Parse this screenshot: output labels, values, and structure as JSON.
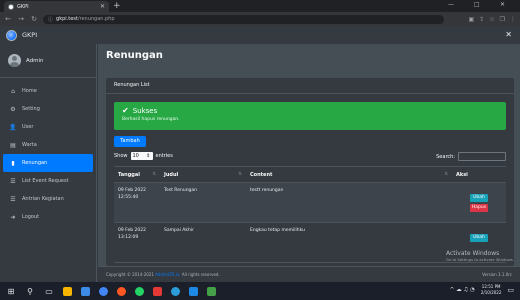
{
  "browser": {
    "tab_title": "GKPI",
    "url_host": "gkpi.test",
    "url_path": "/renungan.php"
  },
  "app": {
    "brand": "GKPI",
    "user": "Admin"
  },
  "sidebar": {
    "items": [
      {
        "label": "Home",
        "icon": "home-icon",
        "glyph": "⌂"
      },
      {
        "label": "Setting",
        "icon": "gears-icon",
        "glyph": "⚙"
      },
      {
        "label": "User",
        "icon": "user-icon",
        "glyph": "👤"
      },
      {
        "label": "Warta",
        "icon": "newspaper-icon",
        "glyph": "▤"
      },
      {
        "label": "Renungan",
        "icon": "book-icon",
        "glyph": "▮",
        "active": true
      },
      {
        "label": "List Event Request",
        "icon": "list-icon",
        "glyph": "☰"
      },
      {
        "label": "Antrian Kegiatan",
        "icon": "list-icon",
        "glyph": "☰"
      },
      {
        "label": "Logout",
        "icon": "logout-icon",
        "glyph": "➜"
      }
    ]
  },
  "main": {
    "page_title": "Renungan",
    "card_title": "Renungan List",
    "alert": {
      "title": "Sukses",
      "message": "Berhasil hapus renungan."
    },
    "add_button": "Tambah",
    "show_label": "Show",
    "entries_value": "10",
    "entries_label": "entries",
    "search_label": "Search:",
    "table": {
      "headers": [
        "Tanggal",
        "Judul",
        "Content",
        "Aksi"
      ],
      "rows": [
        {
          "tanggal": "09 Feb 2022",
          "jam": "12:55:40",
          "judul": "Test Renungan",
          "content": "testt renungan",
          "ubah": "Ubah",
          "hapus": "Hapus"
        },
        {
          "tanggal": "09 Feb 2022",
          "jam": "13:12:09",
          "judul": "Sampai Akhir",
          "content": "Engkau tetap memilihku",
          "ubah": "Ubah"
        }
      ]
    }
  },
  "footer": {
    "copyright_prefix": "Copyright © 2014-2021",
    "copyright_link": "AdminLTE.io.",
    "copyright_suffix": "All rights reserved.",
    "version": "Version 3.1.0rc"
  },
  "watermark": {
    "title": "Activate Windows",
    "subtitle": "Go to Settings to activate Windows."
  },
  "taskbar": {
    "time": "12:51 PM",
    "date": "2/10/2022"
  }
}
